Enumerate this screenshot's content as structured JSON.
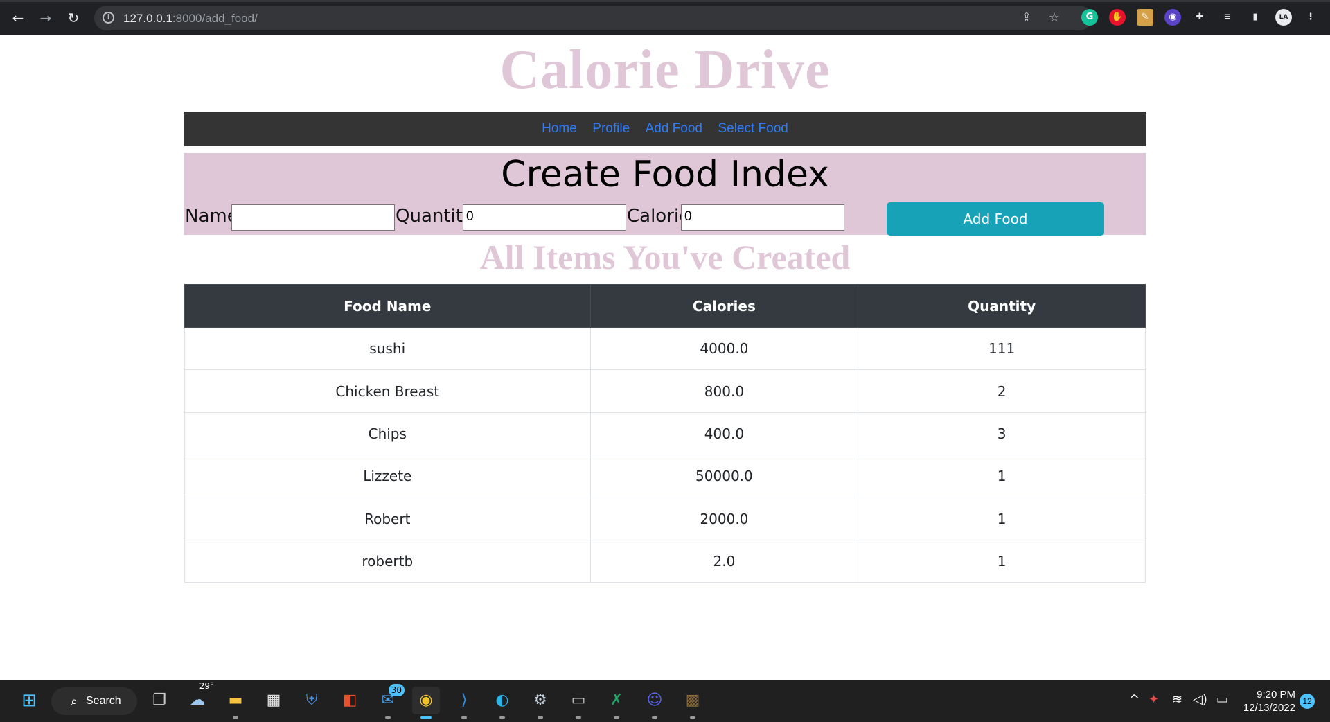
{
  "browser": {
    "url_host": "127.0.0.1",
    "url_path": ":8000/add_food/",
    "extensions": [
      "grammarly-icon",
      "red-extension-icon",
      "notes-extension-icon",
      "purple-extension-icon",
      "puzzle-icon",
      "reading-list-icon",
      "sidebar-icon",
      "profile-avatar-icon",
      "menu-kebab-icon"
    ],
    "ext_labels": {
      "grammarly": "G",
      "profile": "LA"
    }
  },
  "site": {
    "title": "Calorie Drive",
    "nav": [
      "Home",
      "Profile",
      "Add Food",
      "Select Food"
    ]
  },
  "create_form": {
    "title": "Create Food Index",
    "name_label": "Name",
    "name_value": "",
    "quantity_label": "Quantity",
    "quantity_value": "0",
    "calorie_label": "Calorie",
    "calorie_value": "0",
    "submit_label": "Add Food"
  },
  "items": {
    "title": "All Items You've Created",
    "columns": [
      "Food Name",
      "Calories",
      "Quantity"
    ],
    "rows": [
      [
        "sushi",
        "4000.0",
        "111"
      ],
      [
        "Chicken Breast",
        "800.0",
        "2"
      ],
      [
        "Chips",
        "400.0",
        "3"
      ],
      [
        "Lizzete",
        "50000.0",
        "1"
      ],
      [
        "Robert",
        "2000.0",
        "1"
      ],
      [
        "robertb",
        "2.0",
        "1"
      ]
    ]
  },
  "taskbar": {
    "search_label": "Search",
    "weather_temp": "29°",
    "mail_badge": "30",
    "time": "9:20 PM",
    "date": "12/13/2022",
    "notifications": "12"
  },
  "colors": {
    "accent_pink": "#e0c7d7",
    "nav_link": "#2f7cf6",
    "button": "#17a2b8",
    "table_header": "#343a40"
  }
}
